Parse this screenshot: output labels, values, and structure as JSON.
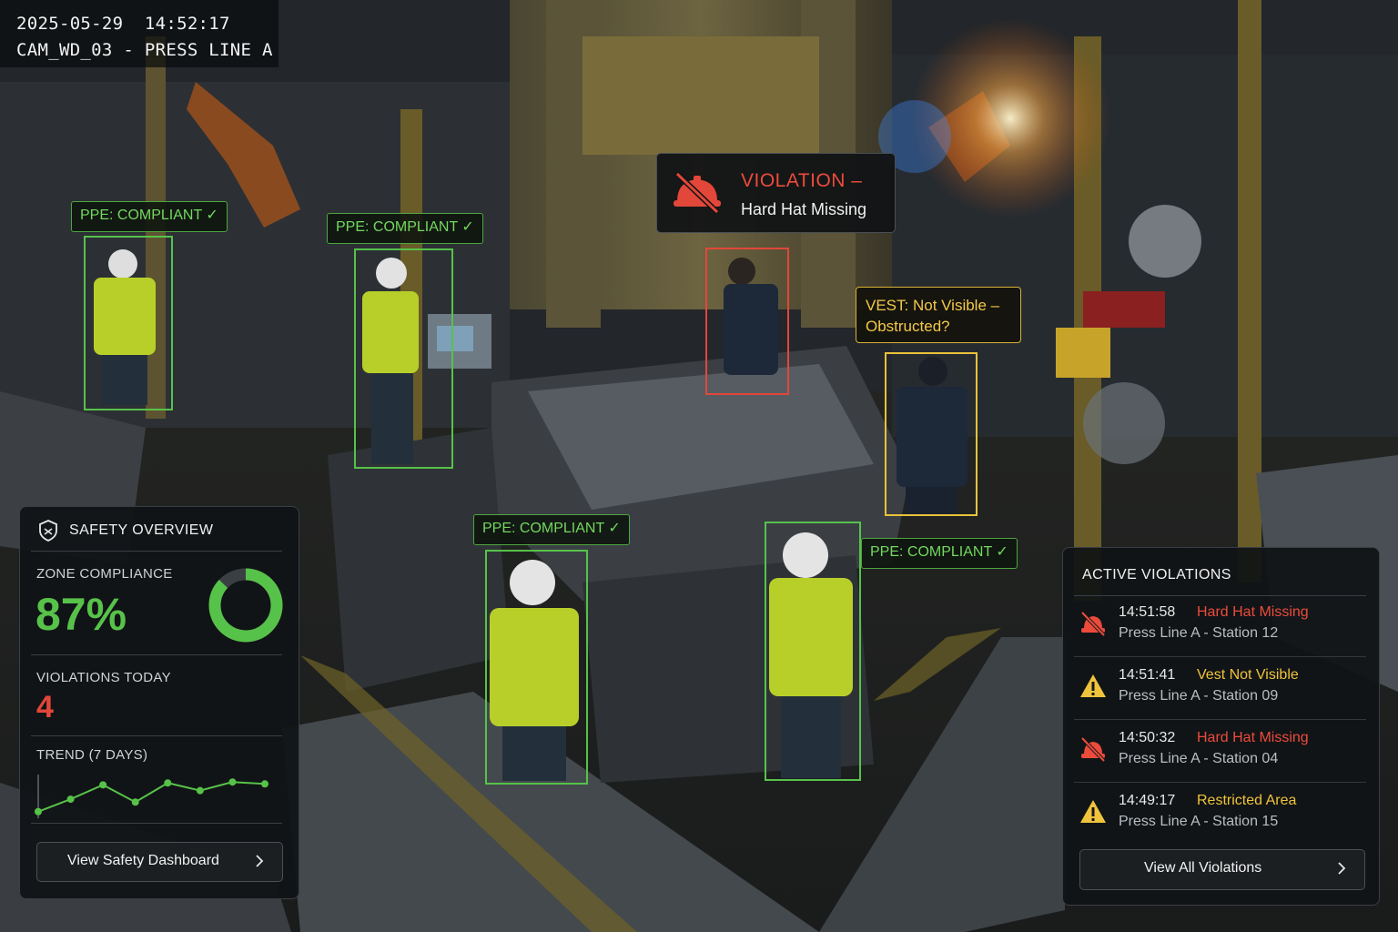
{
  "camera": {
    "timestamp": "2025-05-29  14:52:17",
    "label": "CAM_WD_03 - PRESS LINE A"
  },
  "detections": {
    "compliant_tag": "PPE: COMPLIANT ✓",
    "violation": {
      "title": "VIOLATION –",
      "subtitle": "Hard Hat Missing",
      "icon": "hard-hat-slash-icon",
      "color": "#ec4b3c"
    },
    "vest_warning": {
      "line1": "VEST: Not Visible –",
      "line2": "Obstructed?",
      "color": "#f3c94a"
    }
  },
  "safety_overview": {
    "title": "SAFETY OVERVIEW",
    "icon": "shield-icon",
    "zone_compliance_label": "ZONE COMPLIANCE",
    "zone_compliance_value": "87%",
    "zone_compliance_fraction": 0.87,
    "violations_today_label": "VIOLATIONS TODAY",
    "violations_today_value": "4",
    "trend_label": "TREND (7 DAYS)",
    "trend_values": [
      0.5,
      1.8,
      3.3,
      1.5,
      3.5,
      2.7,
      3.6,
      3.4
    ],
    "button_label": "View Safety Dashboard"
  },
  "active_violations": {
    "title": "ACTIVE VIOLATIONS",
    "items": [
      {
        "time": "14:51:58",
        "type": "Hard Hat Missing",
        "location": "Press Line A - Station 12",
        "icon": "hard-hat-slash-icon",
        "color": "#ec4b3c"
      },
      {
        "time": "14:51:41",
        "type": "Vest Not Visible",
        "location": "Press Line A - Station 09",
        "icon": "warning-triangle-icon",
        "color": "#f0c33c"
      },
      {
        "time": "14:50:32",
        "type": "Hard Hat Missing",
        "location": "Press Line A - Station 04",
        "icon": "hard-hat-slash-icon",
        "color": "#ec4b3c"
      },
      {
        "time": "14:49:17",
        "type": "Restricted Area",
        "location": "Press Line A - Station 15",
        "icon": "warning-triangle-icon",
        "color": "#f0c33c"
      }
    ],
    "button_label": "View All Violations"
  },
  "colors": {
    "compliant": "#57c24a",
    "violation": "#e2473a",
    "warning": "#e9c23a"
  }
}
